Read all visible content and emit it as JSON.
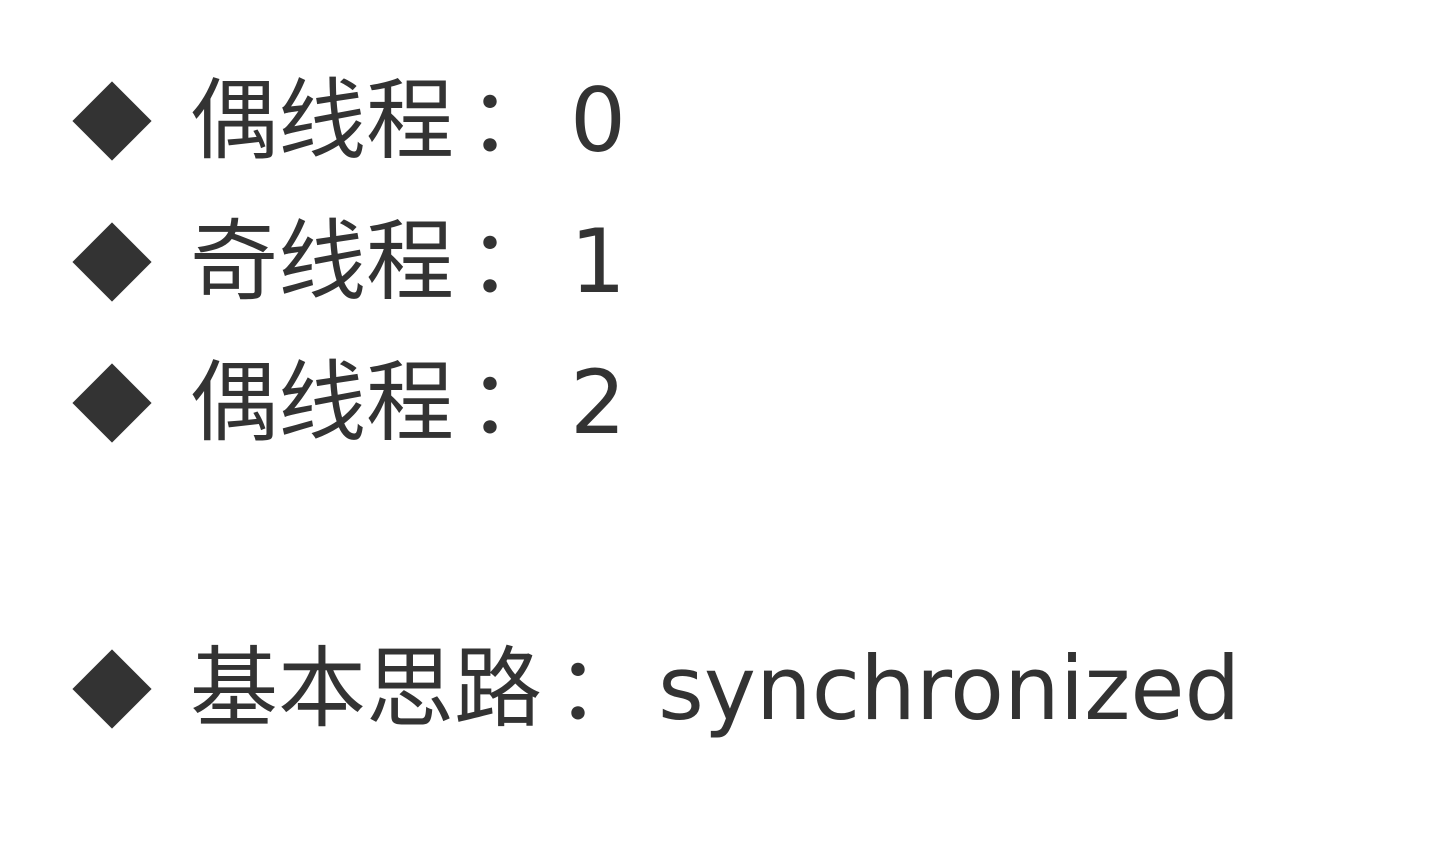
{
  "items": [
    {
      "label": "偶线程",
      "separator": "：",
      "value": "0"
    },
    {
      "label": "奇线程",
      "separator": "：",
      "value": "1"
    },
    {
      "label": "偶线程",
      "separator": "：",
      "value": "2"
    },
    {
      "label": "基本思路",
      "separator": "：",
      "value": "synchronized"
    }
  ],
  "colors": {
    "text": "#333333",
    "background": "#ffffff",
    "bullet": "#333333"
  },
  "icons": {
    "bullet": "diamond-bullet-icon"
  }
}
